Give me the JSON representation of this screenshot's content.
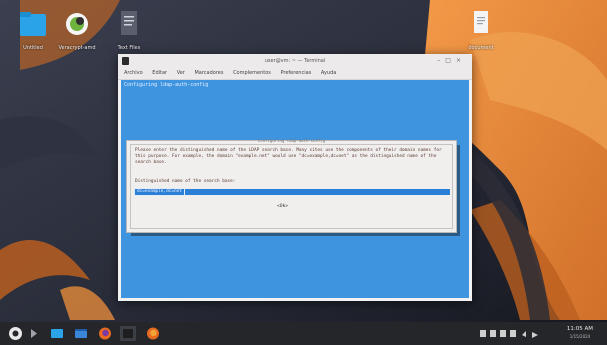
{
  "desktop": {
    "icons": [
      {
        "label": "Untitled"
      },
      {
        "label": "Veracrypt-amd"
      },
      {
        "label": "Text Files"
      },
      {
        "label": "document"
      }
    ]
  },
  "window": {
    "title": "user@vm: ~ — Terminal",
    "menu": [
      "Archivo",
      "Editar",
      "Ver",
      "Marcadores",
      "Complementos",
      "Preferencias",
      "Ayuda"
    ],
    "backtitle": "Configuring ldap-auth-config",
    "dialog": {
      "title": "Configuring ldap-auth-config",
      "message": "Please enter the distinguished name of the LDAP search base. Many sites use the components of their domain names for this purpose. For example, the domain \"example.net\" would use \"dc=example,dc=net\" as the distinguished name of the search base.",
      "prompt": "Distinguished name of the search base:",
      "input_value": "dc=example,dc=net",
      "ok_label": "<Ok>"
    }
  },
  "taskbar": {
    "time": "11:05 AM",
    "date": "1/15/2024"
  },
  "colors": {
    "terminal_bg": "#3f94e0",
    "dialog_bg": "#f1eeee",
    "taskbar_bg": "#242629",
    "wallpaper_orange": "#e7893a"
  }
}
